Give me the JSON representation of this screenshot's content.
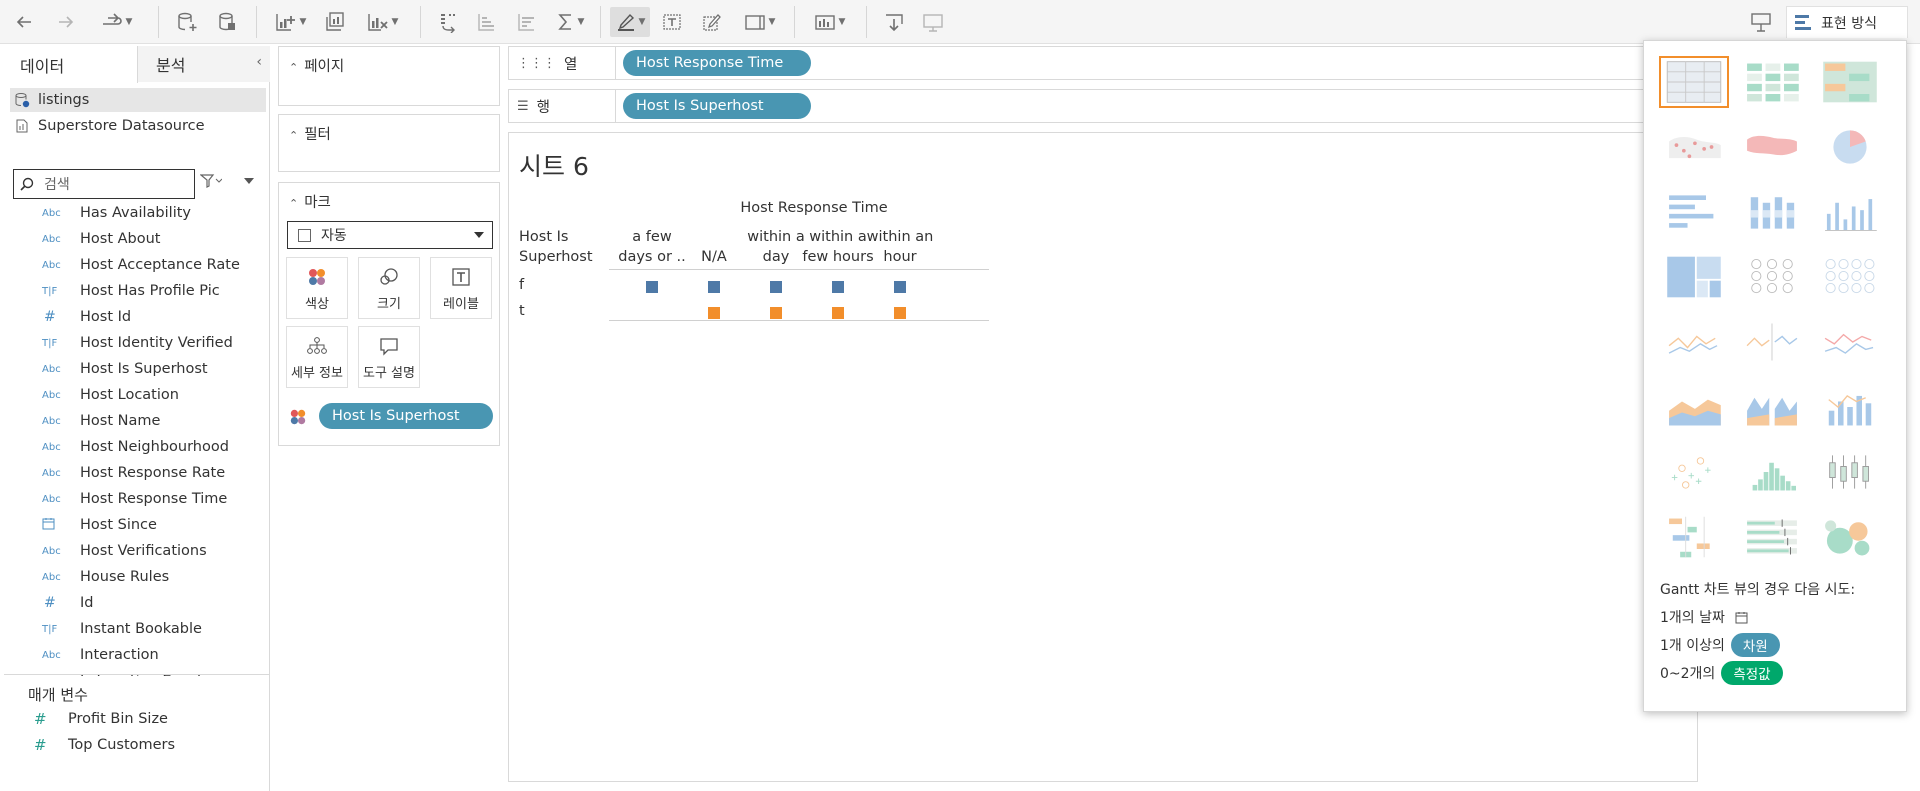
{
  "toolbar": {
    "show_me_label": "표현 방식"
  },
  "data_panel": {
    "tab_data": "데이터",
    "tab_analysis": "분석",
    "datasources": [
      {
        "name": "listings",
        "selected": true
      },
      {
        "name": "Superstore Datasource",
        "selected": false
      }
    ],
    "search_placeholder": "검색",
    "fields": [
      {
        "type": "Abc",
        "name": "Has Availability"
      },
      {
        "type": "Abc",
        "name": "Host About"
      },
      {
        "type": "Abc",
        "name": "Host Acceptance Rate"
      },
      {
        "type": "T|F",
        "name": "Host Has Profile Pic"
      },
      {
        "type": "#",
        "name": "Host Id"
      },
      {
        "type": "T|F",
        "name": "Host Identity Verified"
      },
      {
        "type": "Abc",
        "name": "Host Is Superhost"
      },
      {
        "type": "Abc",
        "name": "Host Location"
      },
      {
        "type": "Abc",
        "name": "Host Name"
      },
      {
        "type": "Abc",
        "name": "Host Neighbourhood"
      },
      {
        "type": "Abc",
        "name": "Host Response Rate"
      },
      {
        "type": "Abc",
        "name": "Host Response Time"
      },
      {
        "type": "date",
        "name": "Host Since"
      },
      {
        "type": "Abc",
        "name": "Host Verifications"
      },
      {
        "type": "Abc",
        "name": "House Rules"
      },
      {
        "type": "#",
        "name": "Id"
      },
      {
        "type": "T|F",
        "name": "Instant Bookable"
      },
      {
        "type": "Abc",
        "name": "Interaction"
      },
      {
        "type": "Abc",
        "name": "Is Location Exact"
      }
    ],
    "params_title": "매개 변수",
    "params": [
      "Profit Bin Size",
      "Top Customers"
    ]
  },
  "cards": {
    "pages_title": "페이지",
    "filters_title": "필터",
    "marks_title": "마크",
    "mark_type": "자동",
    "mark_buttons": {
      "color": "색상",
      "size": "크기",
      "label": "레이블",
      "detail": "세부 정보",
      "tooltip": "도구 설명"
    },
    "color_pill": "Host Is Superhost"
  },
  "shelves": {
    "columns_label": "열",
    "rows_label": "행",
    "columns_pill": "Host Response Time",
    "rows_pill": "Host Is Superhost"
  },
  "view": {
    "sheet_title": "시트 6",
    "col_field": "Host Response Time",
    "row_field_line1": "Host Is",
    "row_field_line2": "Superhost",
    "columns": [
      {
        "l1": "a few",
        "l2": "days or .."
      },
      {
        "l1": "",
        "l2": "N/A"
      },
      {
        "l1": "within a",
        "l2": "day"
      },
      {
        "l1": "within a",
        "l2": "few hours"
      },
      {
        "l1": "within an",
        "l2": "hour"
      }
    ],
    "rows": [
      {
        "label": "f",
        "marks": [
          true,
          true,
          true,
          true,
          true
        ],
        "color": "#4e79a7"
      },
      {
        "label": "t",
        "marks": [
          false,
          true,
          true,
          true,
          true
        ],
        "color": "#f28e2b"
      }
    ]
  },
  "show_me": {
    "hint_title": "Gantt 차트 뷰의 경우 다음 시도:",
    "hint_1": "1개의 날짜",
    "hint_2_prefix": "1개 이상의",
    "hint_2_pill": "차원",
    "hint_3_prefix": "0~2개의",
    "hint_3_pill": "측정값",
    "dimension_color": "#4996b2",
    "measure_color": "#00a86b",
    "chart_types": [
      "text-table",
      "highlight-table",
      "heat-map",
      "symbol-map",
      "filled-map",
      "pie",
      "horizontal-bar",
      "stacked-bar",
      "side-by-side-bar",
      "treemap",
      "circle-view",
      "side-by-side-circle",
      "lines-continuous",
      "lines-discrete",
      "dual-lines",
      "area-continuous",
      "area-discrete",
      "dual-combination",
      "scatter",
      "histogram",
      "box-whisker",
      "gantt",
      "bullet",
      "packed-bubbles"
    ]
  }
}
